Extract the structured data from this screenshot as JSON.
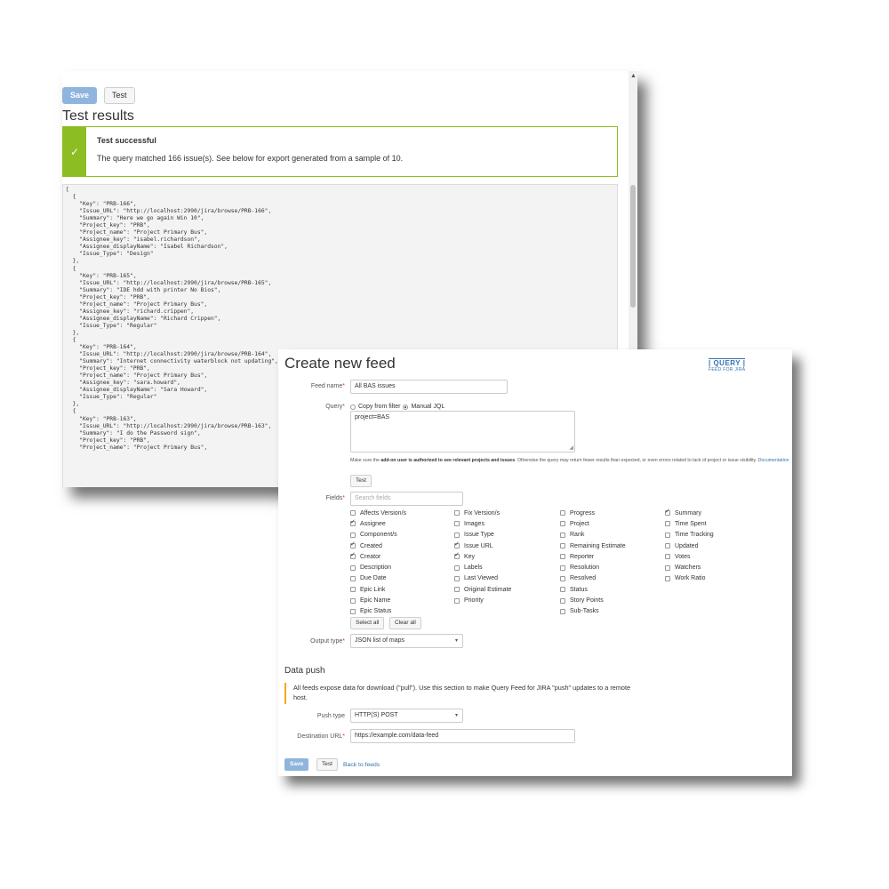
{
  "test_panel": {
    "save_label": "Save",
    "test_label": "Test",
    "title": "Test results",
    "success_title": "Test successful",
    "success_message": "The query matched 166 issue(s). See below for export generated from a sample of 10.",
    "code": "[\n  {\n    \"Key\": \"PRB-166\",\n    \"Issue_URL\": \"http://localhost:2990/jira/browse/PRB-166\",\n    \"Summary\": \"Here we go again Win 10\",\n    \"Project_key\": \"PRB\",\n    \"Project_name\": \"Project Primary Bus\",\n    \"Assignee_key\": \"isabel.richardson\",\n    \"Assignee_displayName\": \"Isabel Richardson\",\n    \"Issue_Type\": \"Design\"\n  },\n  {\n    \"Key\": \"PRB-165\",\n    \"Issue_URL\": \"http://localhost:2990/jira/browse/PRB-165\",\n    \"Summary\": \"IDE hdd with printer No Bios\",\n    \"Project_key\": \"PRB\",\n    \"Project_name\": \"Project Primary Bus\",\n    \"Assignee_key\": \"richard.crippen\",\n    \"Assignee_displayName\": \"Richard Crippen\",\n    \"Issue_Type\": \"Regular\"\n  },\n  {\n    \"Key\": \"PRB-164\",\n    \"Issue_URL\": \"http://localhost:2990/jira/browse/PRB-164\",\n    \"Summary\": \"Internet connectivity waterblock not updating\",\n    \"Project_key\": \"PRB\",\n    \"Project_name\": \"Project Primary Bus\",\n    \"Assignee_key\": \"sara.howard\",\n    \"Assignee_displayName\": \"Sara Howard\",\n    \"Issue_Type\": \"Regular\"\n  },\n  {\n    \"Key\": \"PRB-163\",\n    \"Issue_URL\": \"http://localhost:2990/jira/browse/PRB-163\",\n    \"Summary\": \"I do the Password sign\",\n    \"Project_key\": \"PRB\",\n    \"Project_name\": \"Project Primary Bus\","
  },
  "feed_form": {
    "title": "Create new feed",
    "logo_line1": "| QUERY |",
    "logo_line2": "FEED FOR JIRA",
    "feed_name_label": "Feed name",
    "feed_name_value": "All BAS issues",
    "query_label": "Query",
    "query_option_filter": "Copy from filter",
    "query_option_jql": "Manual JQL",
    "query_value": "project=BAS",
    "note_before": "Make sure the ",
    "note_bold": "add-on user is authorized to see relevant projects and issues",
    "note_after": ". Otherwise the query may return fewer results than expected, or even errors related to lack of project or issue visibility. ",
    "note_link": "Documentation",
    "test_label": "Test",
    "fields_label": "Fields",
    "search_placeholder": "Search fields",
    "fields_columns": [
      [
        {
          "label": "Affects Version/s",
          "checked": false
        },
        {
          "label": "Assignee",
          "checked": true
        },
        {
          "label": "Component/s",
          "checked": false
        },
        {
          "label": "Created",
          "checked": true
        },
        {
          "label": "Creator",
          "checked": true
        },
        {
          "label": "Description",
          "checked": false
        },
        {
          "label": "Due Date",
          "checked": false
        },
        {
          "label": "Epic Link",
          "checked": false
        },
        {
          "label": "Epic Name",
          "checked": false
        },
        {
          "label": "Epic Status",
          "checked": false
        }
      ],
      [
        {
          "label": "Fix Version/s",
          "checked": false
        },
        {
          "label": "Images",
          "checked": false
        },
        {
          "label": "Issue Type",
          "checked": false
        },
        {
          "label": "Issue URL",
          "checked": true
        },
        {
          "label": "Key",
          "checked": true
        },
        {
          "label": "Labels",
          "checked": false
        },
        {
          "label": "Last Viewed",
          "checked": false
        },
        {
          "label": "Original Estimate",
          "checked": false
        },
        {
          "label": "Priority",
          "checked": false
        }
      ],
      [
        {
          "label": "Progress",
          "checked": false
        },
        {
          "label": "Project",
          "checked": false
        },
        {
          "label": "Rank",
          "checked": false
        },
        {
          "label": "Remaining Estimate",
          "checked": false
        },
        {
          "label": "Reporter",
          "checked": false
        },
        {
          "label": "Resolution",
          "checked": false
        },
        {
          "label": "Resolved",
          "checked": false
        },
        {
          "label": "Status",
          "checked": false
        },
        {
          "label": "Story Points",
          "checked": false
        },
        {
          "label": "Sub-Tasks",
          "checked": false
        }
      ],
      [
        {
          "label": "Summary",
          "checked": true
        },
        {
          "label": "Time Spent",
          "checked": false
        },
        {
          "label": "Time Tracking",
          "checked": false
        },
        {
          "label": "Updated",
          "checked": false
        },
        {
          "label": "Votes",
          "checked": false
        },
        {
          "label": "Watchers",
          "checked": false
        },
        {
          "label": "Work Ratio",
          "checked": false
        }
      ]
    ],
    "select_all_label": "Select all",
    "clear_all_label": "Clear all",
    "output_type_label": "Output type",
    "output_type_value": "JSON list of maps",
    "data_push_title": "Data push",
    "data_push_note": "All feeds expose data for download (\"pull\"). Use this section to make Query Feed for JIRA \"push\" updates to a remote host.",
    "push_type_label": "Push type",
    "push_type_value": "HTTP(S) POST",
    "destination_label": "Destination URL",
    "destination_value": "https://example.com/data-feed",
    "save_label": "Save",
    "back_link": "Back to feeds"
  },
  "colors": {
    "success": "#8cbd22",
    "primary_button": "#8fb5de",
    "link": "#3572b0",
    "warning": "#f6a623",
    "required": "#d04437"
  }
}
